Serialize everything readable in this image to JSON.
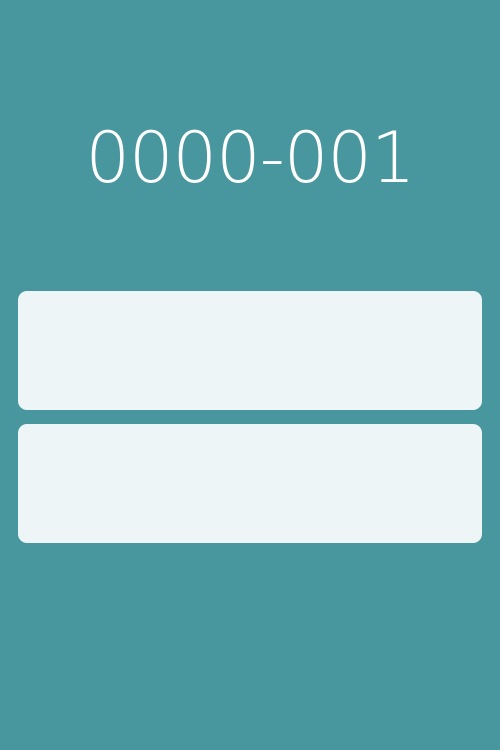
{
  "screen": {
    "code": "0000-001"
  },
  "colors": {
    "background": "#48979f",
    "card": "#edf5f7",
    "text": "#ffffff"
  },
  "cards": [
    {
      "label": ""
    },
    {
      "label": ""
    }
  ]
}
